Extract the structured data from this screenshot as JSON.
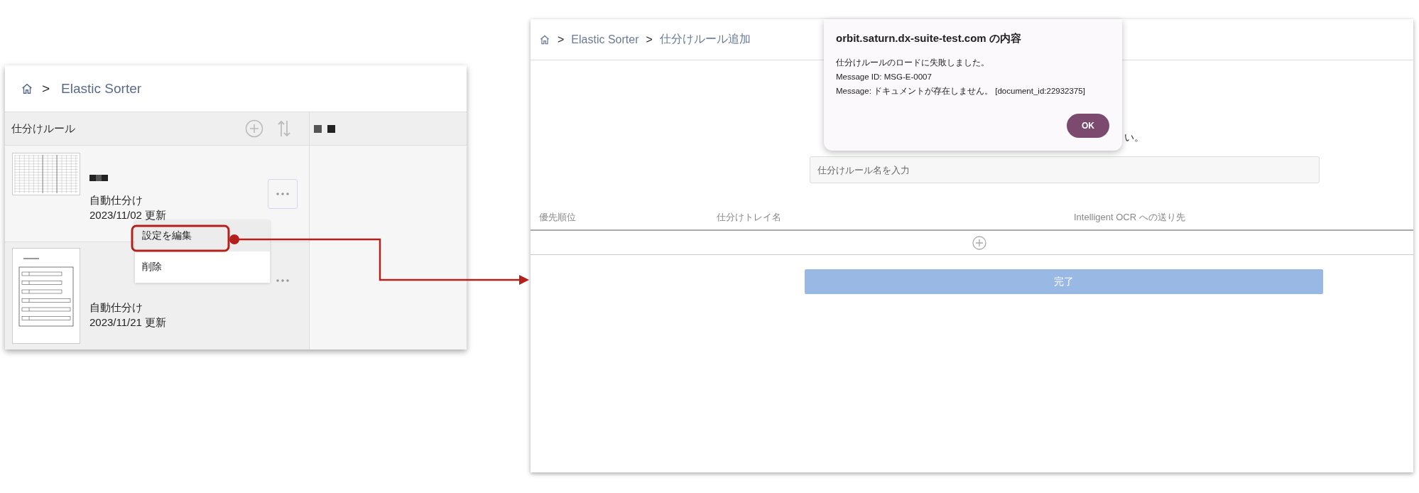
{
  "left_panel": {
    "breadcrumb": [
      {
        "separator": ">",
        "label": "Elastic Sorter"
      }
    ],
    "list_title": "仕分けルール",
    "rules": [
      {
        "kind": "grid",
        "kind_label": "自動仕分け",
        "updated": "2023/11/02 更新",
        "menu_open": true
      },
      {
        "kind": "form",
        "kind_label": "自動仕分け",
        "updated": "2023/11/21 更新",
        "menu_open": false
      }
    ],
    "context_menu": [
      {
        "label": "設定を編集",
        "selected": true
      },
      {
        "label": "削除",
        "selected": false
      }
    ]
  },
  "right_panel": {
    "breadcrumb": [
      {
        "separator": ">",
        "label": "Elastic Sorter"
      },
      {
        "separator": ">",
        "label": "仕分けルール追加"
      }
    ],
    "instruction_tail": "い。",
    "name_field": {
      "placeholder": "仕分けルール名を入力"
    },
    "table": {
      "columns": [
        "優先順位",
        "仕分けトレイ名",
        "Intelligent OCR への送り先"
      ]
    },
    "submit_button": "完了",
    "dialog": {
      "title": "orbit.saturn.dx-suite-test.com の内容",
      "lines": [
        "仕分けルールのロードに失敗しました。",
        "Message ID: MSG-E-0007",
        "Message: ドキュメントが存在しません。 [document_id:22932375]"
      ],
      "ok_button": "OK"
    }
  }
}
